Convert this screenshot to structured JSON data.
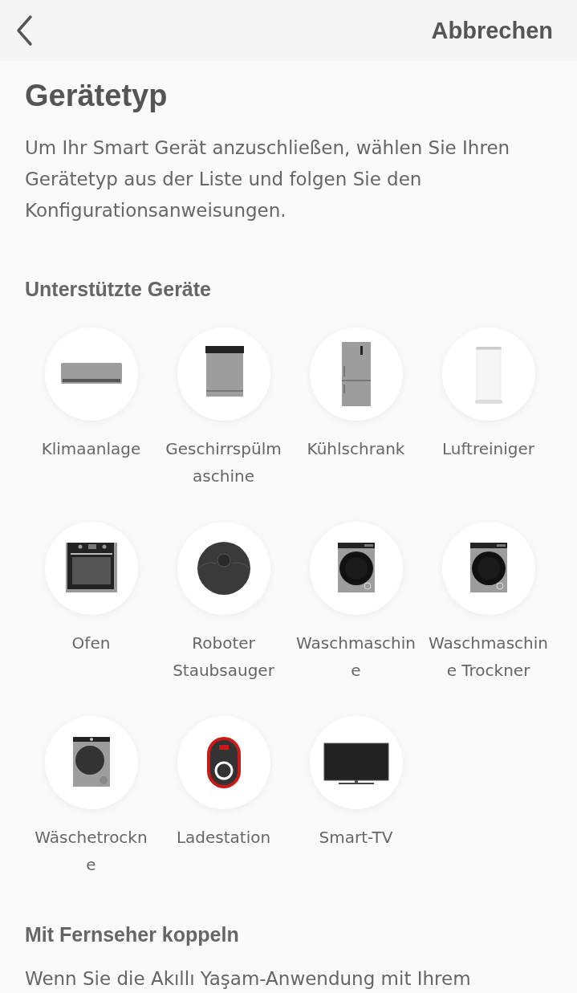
{
  "header": {
    "cancel": "Abbrechen"
  },
  "title": "Gerätetyp",
  "intro": "Um Ihr Smart Gerät anzuschließen, wählen Sie Ihren Gerätetyp aus der Liste und folgen Sie den Konfigurationsanweisungen.",
  "supported": {
    "heading": "Unterstützte Geräte",
    "devices": [
      {
        "kind": "ac",
        "label": "Klimaanlage"
      },
      {
        "kind": "dishwasher",
        "label": "Geschirrspülmaschine"
      },
      {
        "kind": "fridge",
        "label": "Kühlschrank"
      },
      {
        "kind": "purifier",
        "label": "Luftreiniger"
      },
      {
        "kind": "oven",
        "label": "Ofen"
      },
      {
        "kind": "robot",
        "label": "Roboter Staubsauger"
      },
      {
        "kind": "washer",
        "label": "Waschmaschine"
      },
      {
        "kind": "washer",
        "label": "Waschmaschine Trockner"
      },
      {
        "kind": "dryer",
        "label": "Wäschetrockne"
      },
      {
        "kind": "charger",
        "label": "Ladestation"
      },
      {
        "kind": "tv",
        "label": "Smart-TV"
      }
    ]
  },
  "tv_pairing": {
    "heading": "Mit Fernseher koppeln",
    "text": "Wenn Sie die Akıllı Yaşam-Anwendung mit Ihrem"
  }
}
